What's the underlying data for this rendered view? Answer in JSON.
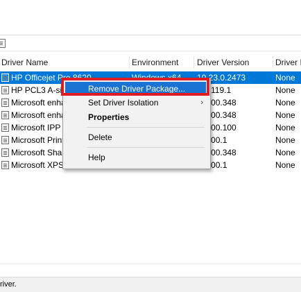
{
  "columns": [
    "Driver Name",
    "Environment",
    "Driver Version",
    "Driver Is"
  ],
  "rows": [
    {
      "name": "HP Officejet Pro 8620",
      "environment": "Windows x64",
      "version": "10.23.0.2473",
      "isolation": "None",
      "selected": true
    },
    {
      "name": "HP PCL3 A-size",
      "environment": "",
      "version": "717119.1",
      "isolation": "None"
    },
    {
      "name": "Microsoft enha",
      "environment": "",
      "version": "22000.348",
      "isolation": "None"
    },
    {
      "name": "Microsoft enha",
      "environment": "",
      "version": "22000.348",
      "isolation": "None"
    },
    {
      "name": "Microsoft IPP C",
      "environment": "",
      "version": "22000.100",
      "isolation": "None"
    },
    {
      "name": "Microsoft Print",
      "environment": "",
      "version": "22000.1",
      "isolation": "None"
    },
    {
      "name": "Microsoft Shar",
      "environment": "",
      "version": "22000.348",
      "isolation": "None"
    },
    {
      "name": "Microsoft XPS D",
      "environment": "",
      "version": "22000.1",
      "isolation": "None"
    }
  ],
  "context_menu": {
    "remove": "Remove Driver Package...",
    "isolation": "Set Driver Isolation",
    "isolation_arrow": "›",
    "properties": "Properties",
    "delete": "Delete",
    "help": "Help"
  },
  "status": {
    "text": "river."
  },
  "colors": {
    "selection": "#0078d7",
    "menu_highlight": "#1a73d2",
    "annotation": "#e11b22"
  }
}
